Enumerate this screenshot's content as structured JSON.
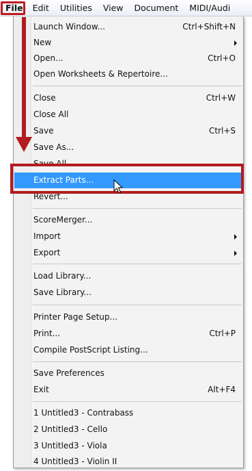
{
  "menubar": {
    "items": [
      "File",
      "Edit",
      "Utilities",
      "View",
      "Document",
      "MIDI/Audi"
    ]
  },
  "menu": {
    "items": [
      {
        "label": "Launch Window...",
        "shortcut": "Ctrl+Shift+N"
      },
      {
        "label": "New",
        "submenu": true
      },
      {
        "label": "Open...",
        "shortcut": "Ctrl+O"
      },
      {
        "label": "Open Worksheets & Repertoire..."
      },
      {
        "label": "Close",
        "shortcut": "Ctrl+W"
      },
      {
        "label": "Close All"
      },
      {
        "label": "Save",
        "shortcut": "Ctrl+S"
      },
      {
        "label": "Save As..."
      },
      {
        "label": "Save All"
      },
      {
        "label": "Extract Parts...",
        "active": true
      },
      {
        "label": "Revert..."
      },
      {
        "label": "ScoreMerger..."
      },
      {
        "label": "Import",
        "submenu": true
      },
      {
        "label": "Export",
        "submenu": true
      },
      {
        "label": "Load Library..."
      },
      {
        "label": "Save Library..."
      },
      {
        "label": "Printer Page Setup..."
      },
      {
        "label": "Print...",
        "shortcut": "Ctrl+P"
      },
      {
        "label": "Compile PostScript Listing..."
      },
      {
        "label": "Save Preferences"
      },
      {
        "label": "Exit",
        "shortcut": "Alt+F4"
      },
      {
        "label": "1 Untitled3 - Contrabass"
      },
      {
        "label": "2 Untitled3 - Cello"
      },
      {
        "label": "3 Untitled3 - Viola"
      },
      {
        "label": "4 Untitled3 - Violin II"
      }
    ]
  },
  "colors": {
    "highlight": "#3399ff",
    "annotation_red": "#b31b20"
  },
  "icons": {
    "cursor": "arrow-cursor-icon",
    "annotation": "red-down-arrow"
  }
}
